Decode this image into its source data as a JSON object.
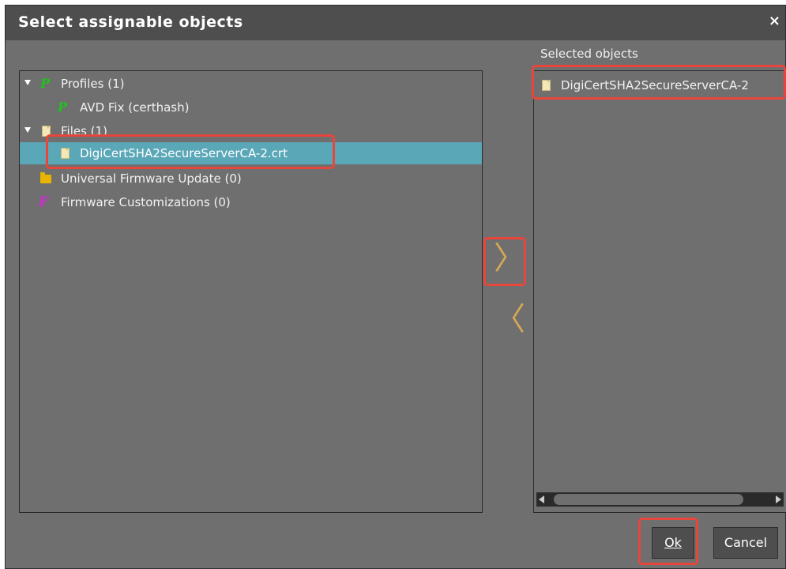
{
  "dialog": {
    "title": "Select assignable objects",
    "close_label": "×"
  },
  "tree": {
    "items": [
      {
        "label": "Profiles (1)",
        "icon": "profile-icon"
      },
      {
        "label": "AVD Fix (certhash)",
        "icon": "profile-icon"
      },
      {
        "label": "Files (1)",
        "icon": "file-icon"
      },
      {
        "label": "DigiCertSHA2SecureServerCA-2.crt",
        "icon": "file-icon",
        "selected": true
      },
      {
        "label": "Universal Firmware Update (0)",
        "icon": "folder-icon"
      },
      {
        "label": "Firmware Customizations (0)",
        "icon": "firmware-icon"
      }
    ]
  },
  "selected_panel": {
    "label": "Selected objects",
    "items": [
      {
        "label": "DigiCertSHA2SecureServerCA-2",
        "icon": "file-icon"
      }
    ]
  },
  "transfer": {
    "add_label": "〉",
    "remove_label": "〈"
  },
  "buttons": {
    "ok_label": "Ok",
    "cancel_label": "Cancel"
  },
  "colors": {
    "background": "#6f6f6f",
    "titlebar": "#4e4e4e",
    "selection": "#5aa7b8",
    "highlight": "#e8453c",
    "arrow": "#d4a856",
    "profile_icon": "#1fc31f",
    "firmware_icon": "#d227d2",
    "folder_icon": "#e8b400"
  }
}
